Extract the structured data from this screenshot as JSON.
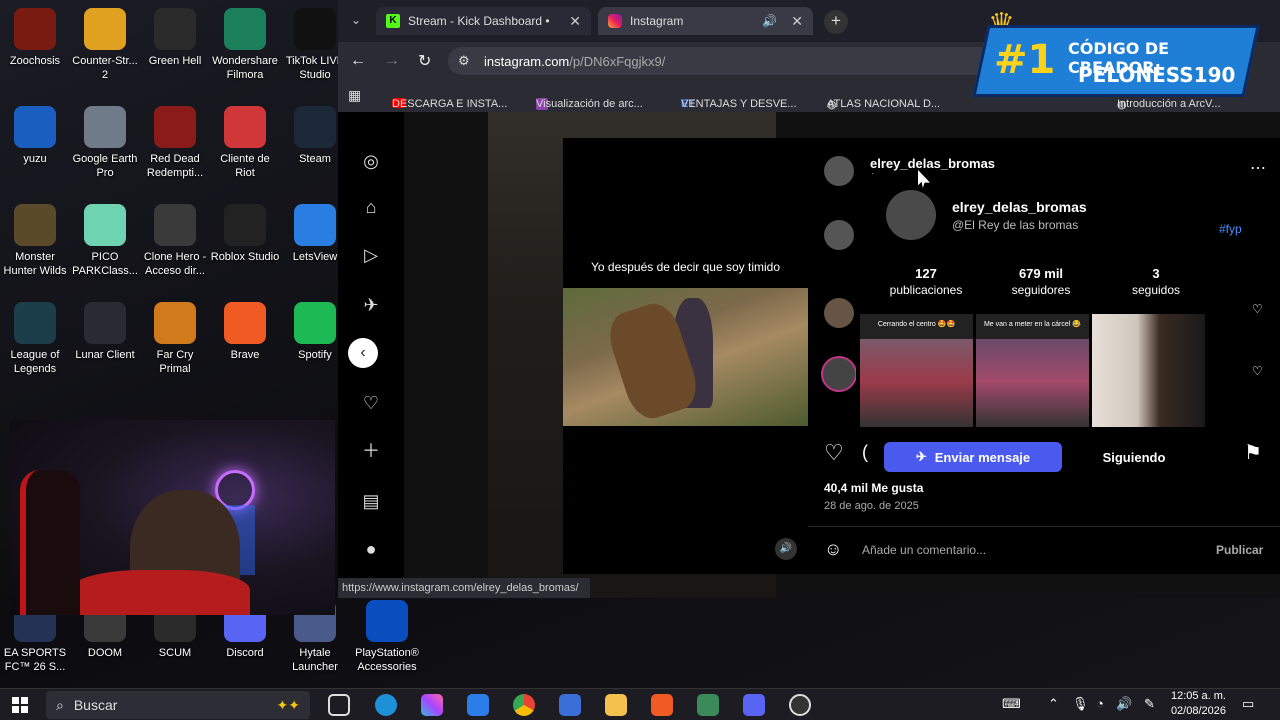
{
  "desktop": {
    "icons": [
      {
        "label": "Zoochosis",
        "color": "#7a1b12"
      },
      {
        "label": "Counter-Str... 2",
        "color": "#e0a020"
      },
      {
        "label": "Green Hell",
        "color": "#2a2a2a"
      },
      {
        "label": "Wondershare Filmora",
        "color": "#1a7f5a"
      },
      {
        "label": "TikTok LIVE Studio",
        "color": "#111111"
      },
      {
        "label": "yuzu",
        "color": "#1a5fbf"
      },
      {
        "label": "Google Earth Pro",
        "color": "#6f7b88"
      },
      {
        "label": "Red Dead Redempti...",
        "color": "#8a1b18"
      },
      {
        "label": "Cliente de Riot",
        "color": "#d13639"
      },
      {
        "label": "Steam",
        "color": "#1b2838"
      },
      {
        "label": "Monster Hunter Wilds",
        "color": "#5a4a2a"
      },
      {
        "label": "PICO PARKClass...",
        "color": "#6ed3b0"
      },
      {
        "label": "Clone Hero - Acceso dir...",
        "color": "#3a3a3a"
      },
      {
        "label": "Roblox Studio",
        "color": "#222222"
      },
      {
        "label": "LetsView",
        "color": "#2a7de1"
      },
      {
        "label": "League of Legends",
        "color": "#1c3d4a"
      },
      {
        "label": "Lunar Client",
        "color": "#2a2a33"
      },
      {
        "label": "Far Cry Primal",
        "color": "#d07a1c"
      },
      {
        "label": "Brave",
        "color": "#f05a23"
      },
      {
        "label": "Spotify",
        "color": "#1db954"
      },
      {
        "label": "EA SPORTS FC™ 26 S...",
        "color": "#223355"
      },
      {
        "label": "DOOM",
        "color": "#3a3a3a"
      },
      {
        "label": "SCUM",
        "color": "#2b2b2b"
      },
      {
        "label": "Discord",
        "color": "#5865f2"
      },
      {
        "label": "Hytale Launcher",
        "color": "#4a5a8a"
      },
      {
        "label": "PlayStation® Accessories",
        "color": "#0a4dbf"
      }
    ]
  },
  "browser": {
    "tabs": [
      {
        "label": "Stream - Kick Dashboard •",
        "icon": "kick-icon",
        "close": "✕"
      },
      {
        "label": "Instagram",
        "icon": "instagram-icon",
        "close": "✕"
      }
    ],
    "new_tab": "+",
    "address_domain": "instagram.com",
    "address_path": "/p/DN6xFqgjkx9/",
    "bookmarks": [
      "DESCARGA E INSTA...",
      "Visualización de arc...",
      "VENTAJAS Y DESVE...",
      "ATLAS NACIONAL D...",
      "Introducción a ArcV..."
    ],
    "status_url": "https://www.instagram.com/elrey_delas_bromas/"
  },
  "banner": {
    "line1": "#1",
    "line2": "CÓDIGO DE CREADOR:",
    "line3": "PELONESS190"
  },
  "instagram": {
    "reel_caption": "Yo después de decir que soy timido",
    "post_username": "elrey_delas_bromas",
    "post_subline": "/",
    "hover_card": {
      "username": "elrey_delas_bromas",
      "full_name": "@El Rey de las bromas",
      "posts_count": "127",
      "posts_label": "publicaciones",
      "followers_count": "679 mil",
      "followers_label": "seguidores",
      "following_count": "3",
      "following_label": "seguidos",
      "thumb1_caption": "Cerrando el centro 🤩🤩",
      "thumb2_caption": "Me van a meter en la cárcel 😂",
      "message_btn": "Enviar mensaje",
      "following_btn": "Siguiendo"
    },
    "side_hashtag": "l #fyp",
    "likes": "40,4 mil Me gusta",
    "date": "28 de ago. de 2025",
    "comment_placeholder": "Añade un comentario...",
    "publish_btn": "Publicar"
  },
  "taskbar": {
    "search_placeholder": "Buscar",
    "time": "12:05 a. m.",
    "date": "02/08/2026"
  }
}
